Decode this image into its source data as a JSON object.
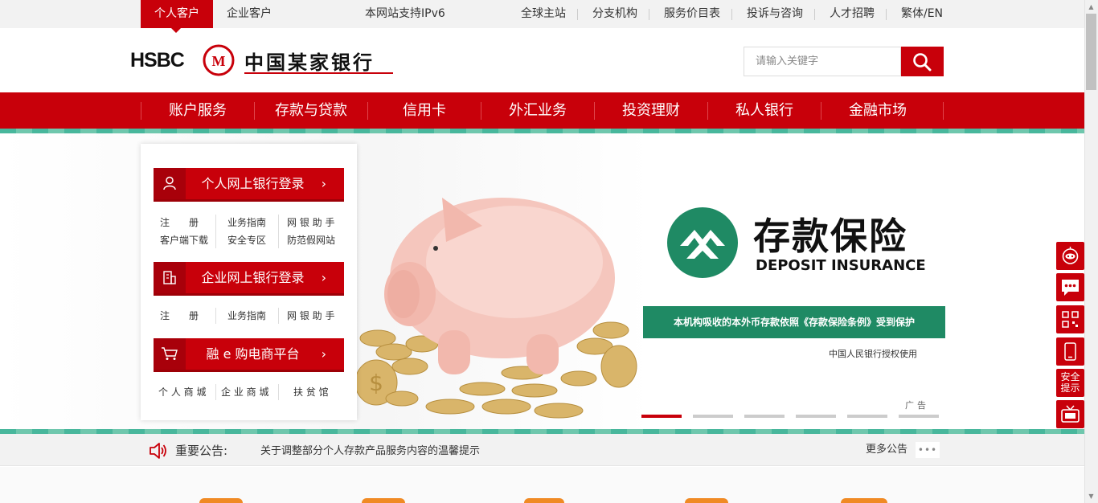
{
  "topbar": {
    "tabs": [
      "个人客户",
      "企业客户"
    ],
    "ipv6": "本网站支持IPv6",
    "links": [
      "全球主站",
      "分支机构",
      "服务价目表",
      "投诉与咨询",
      "人才招聘",
      "繁体/EN"
    ]
  },
  "header": {
    "logo_text": "HSBC",
    "logo_cn": "中国某家银行",
    "search_placeholder": "请输入关键字"
  },
  "nav": {
    "items": [
      "账户服务",
      "存款与贷款",
      "信用卡",
      "外汇业务",
      "投资理财",
      "私人银行",
      "金融市场"
    ]
  },
  "login": {
    "personal": {
      "label": "个人网上银行登录",
      "links": [
        "注　　册",
        "业务指南",
        "网 银 助 手",
        "客户端下载",
        "安全专区",
        "防范假网站"
      ]
    },
    "corporate": {
      "label": "企业网上银行登录",
      "links": [
        "注　　册",
        "业务指南",
        "网 银 助 手"
      ]
    },
    "mall": {
      "label": "融 e 购电商平台",
      "links": [
        "个 人 商 城",
        "企 业 商 城",
        "扶 贫 馆"
      ]
    }
  },
  "banner": {
    "title": "存款保险",
    "subtitle": "DEPOSIT INSURANCE",
    "band_text": "本机构吸收的本外币存款依照《存款保险条例》受到保护",
    "authorized": "中国人民银行授权使用",
    "ad_label": "广告",
    "slide_count": 6,
    "active_slide": 1
  },
  "notice": {
    "label": "重要公告:",
    "text": "关于调整部分个人存款产品服务内容的温馨提示",
    "more": "更多公告",
    "more_dots": "•••"
  },
  "float": {
    "security_line1": "安全",
    "security_line2": "提示"
  },
  "colors": {
    "brand_red": "#c8000a",
    "teal": "#48b79c",
    "deposit_green": "#1f8a64"
  }
}
